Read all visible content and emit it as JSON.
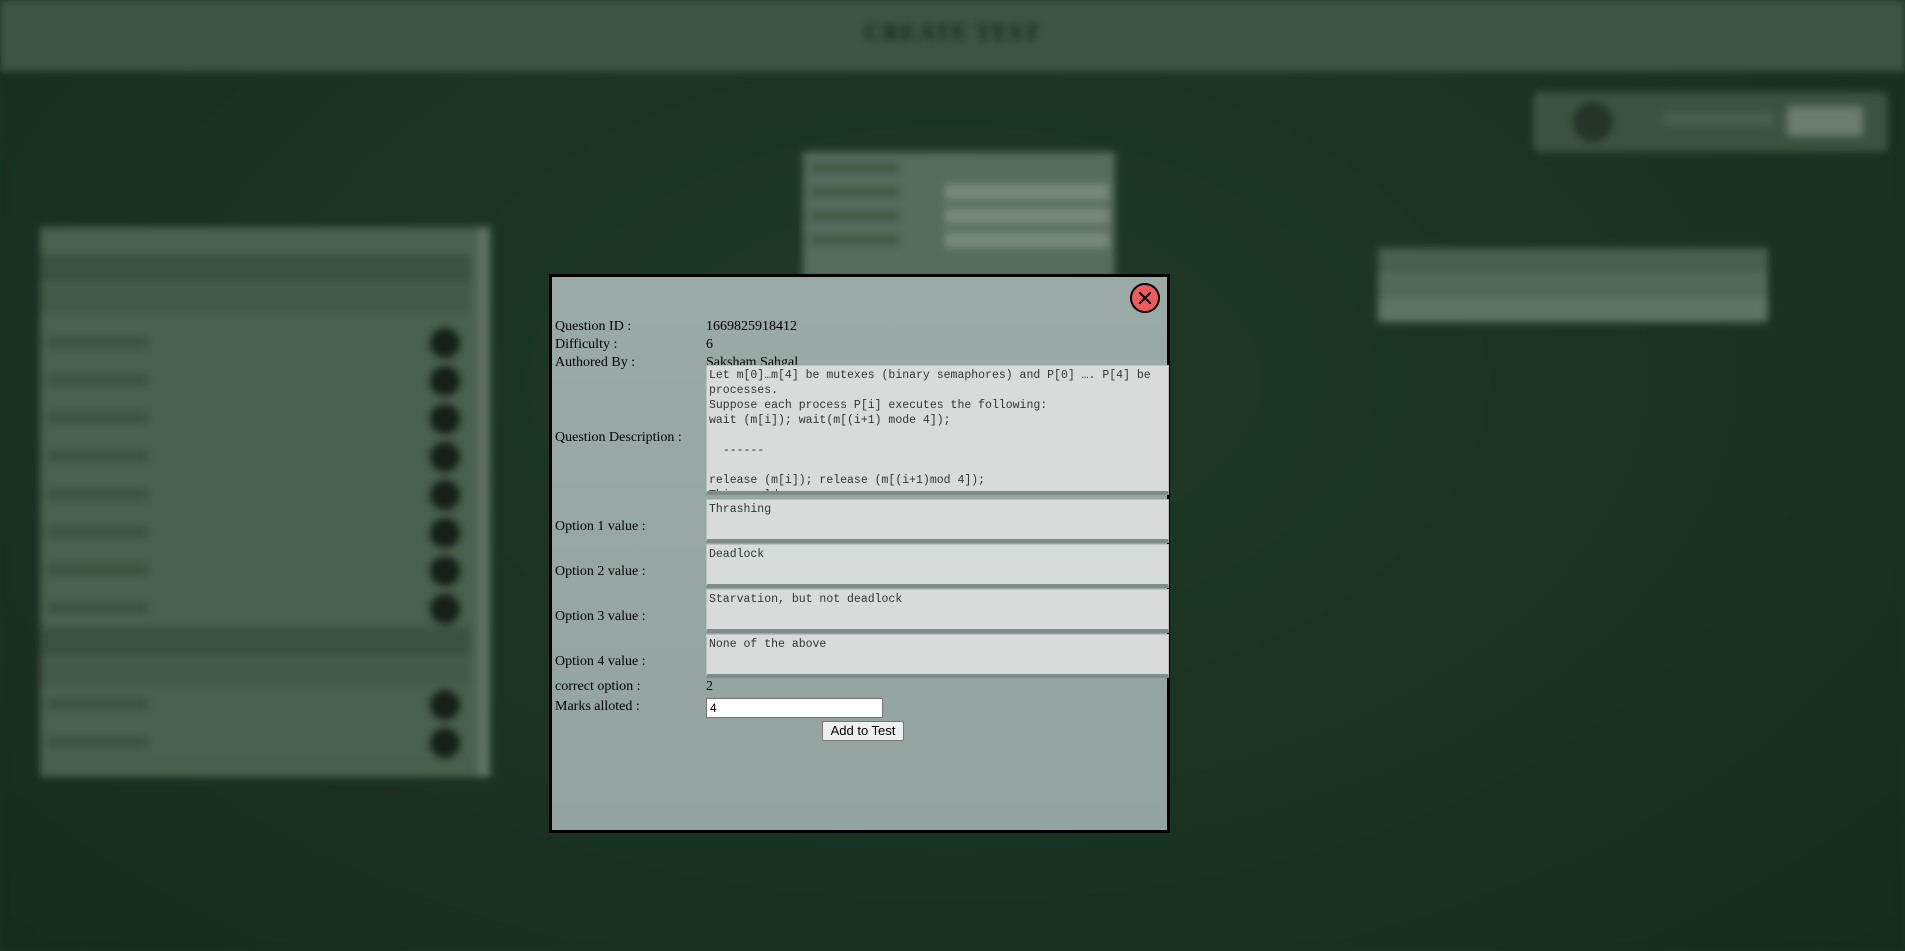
{
  "background": {
    "header_title": "CREATE TEST"
  },
  "modal": {
    "close_icon": "close-icon",
    "fields": {
      "question_id": {
        "label": "Question ID :",
        "value": "1669825918412"
      },
      "difficulty": {
        "label": "Difficulty :",
        "value": "6"
      },
      "authored_by": {
        "label": "Authored By :",
        "value": "Saksham Sahgal"
      },
      "description": {
        "label": "Question Description :",
        "value": "Let m[0]…m[4] be mutexes (binary semaphores) and P[0] …. P[4] be processes.\nSuppose each process P[i] executes the following:\nwait (m[i]); wait(m[(i+1) mode 4]);\n\n  ------\n\nrelease (m[i]); release (m[(i+1)mod 4]);\nThis could cause"
      },
      "option1": {
        "label": "Option 1 value :",
        "value": "Thrashing"
      },
      "option2": {
        "label": "Option 2 value :",
        "value": "Deadlock"
      },
      "option3": {
        "label": "Option 3 value :",
        "value": "Starvation, but not deadlock"
      },
      "option4": {
        "label": "Option 4 value :",
        "value": "None of the above"
      },
      "correct_option": {
        "label": "correct option :",
        "value": "2"
      },
      "marks": {
        "label": "Marks alloted :",
        "value": "4"
      }
    },
    "add_button_label": "Add to Test"
  },
  "colors": {
    "close_button": "#f05a5a",
    "modal_background": "#9aaaa6",
    "page_background": "#1f3a2a"
  }
}
